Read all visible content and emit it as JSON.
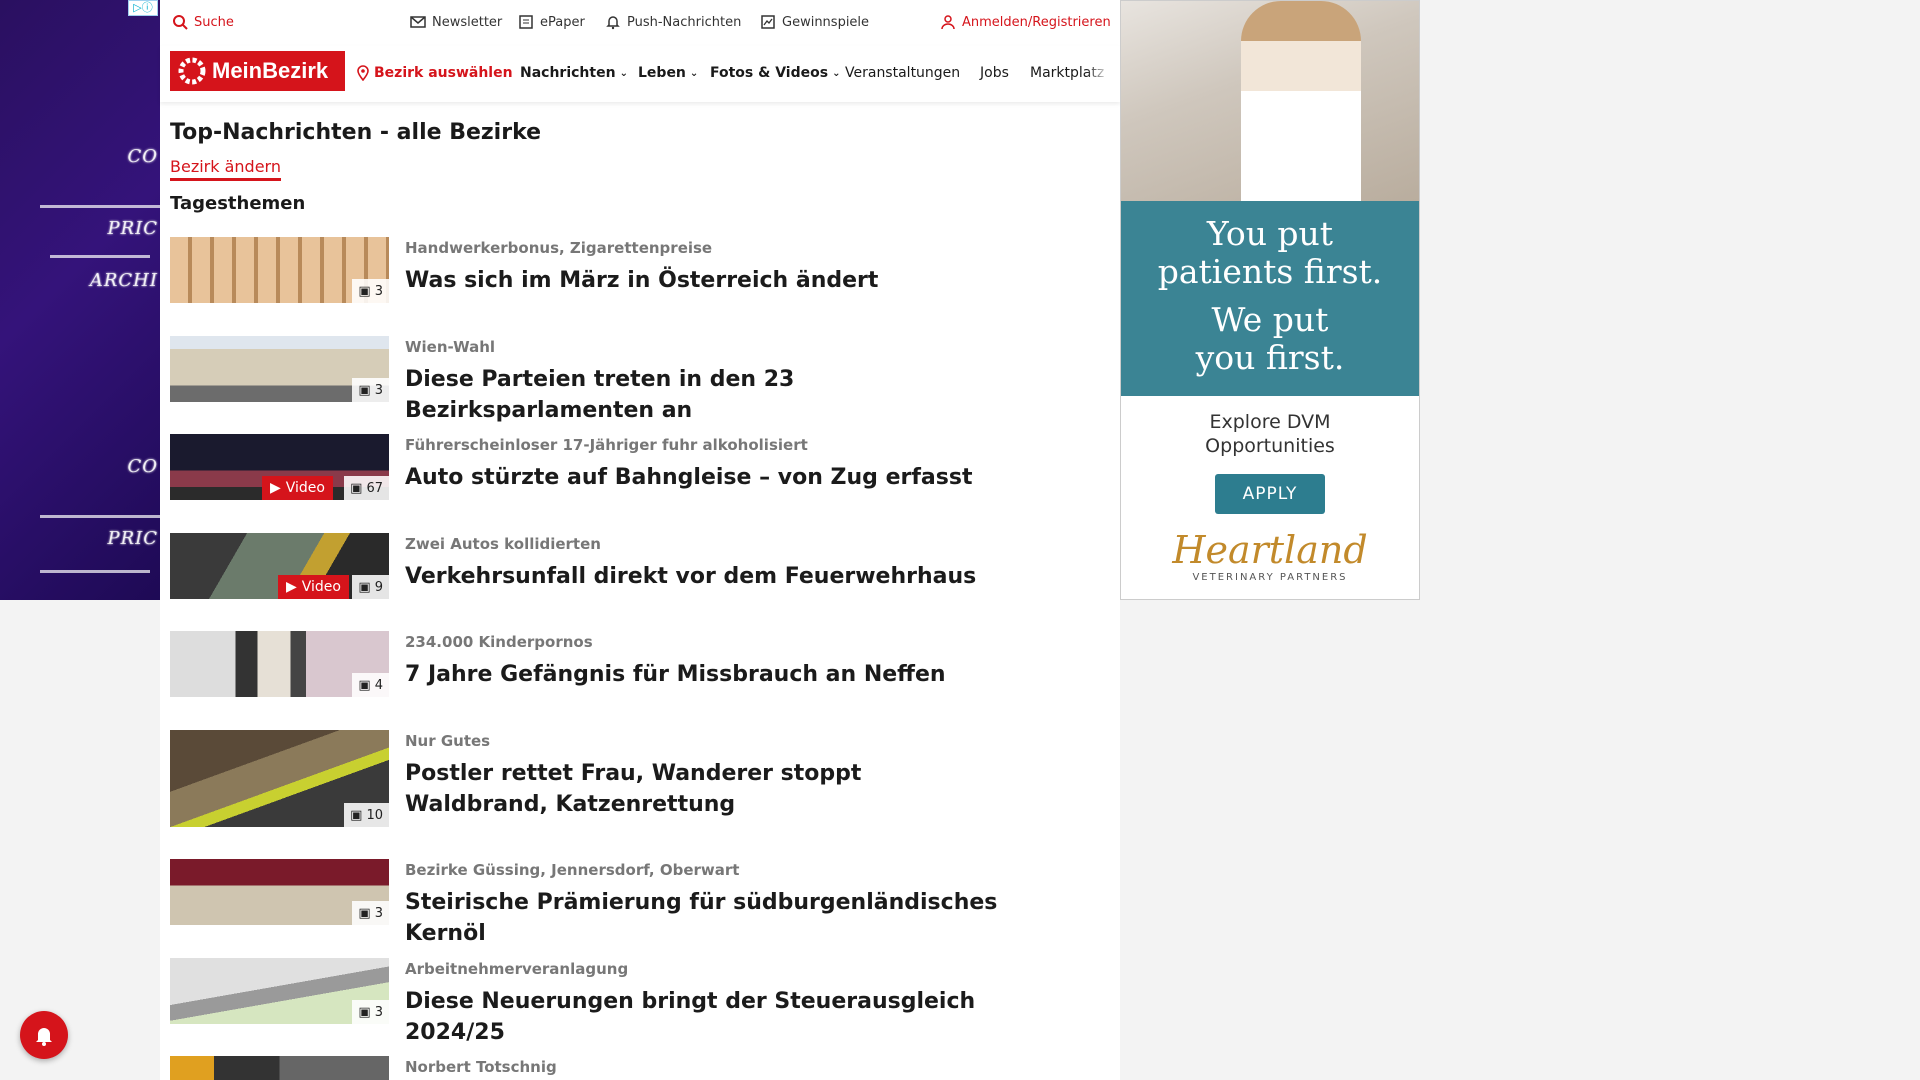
{
  "topbar": {
    "search": "Suche",
    "newsletter": "Newsletter",
    "epaper": "ePaper",
    "push": "Push-Nachrichten",
    "games": "Gewinnspiele",
    "login": "Anmelden/Registrieren"
  },
  "nav": {
    "logo": "MeinBezirk",
    "district": "Bezirk auswählen",
    "items": [
      "Nachrichten",
      "Leben",
      "Fotos & Videos",
      "Veranstaltungen",
      "Jobs",
      "Marktplatz"
    ]
  },
  "page": {
    "title": "Top-Nachrichten - alle Bezirke",
    "change_district": "Bezirk ändern",
    "section": "Tagesthemen"
  },
  "articles": [
    {
      "kicker": "Handwerkerbonus, Zigarettenpreise",
      "headline": "Was sich im März in Österreich ändert",
      "count": "3",
      "video": ""
    },
    {
      "kicker": "Wien-Wahl",
      "headline": "Diese Parteien treten in den 23 Bezirksparlamenten an",
      "count": "3",
      "video": ""
    },
    {
      "kicker": "Führerscheinloser 17-Jähriger fuhr alkoholisiert",
      "headline": "Auto stürzte auf Bahngleise – von Zug erfasst",
      "count": "67",
      "video": "Video"
    },
    {
      "kicker": "Zwei Autos kollidierten",
      "headline": "Verkehrsunfall direkt vor dem Feuerwehrhaus",
      "count": "9",
      "video": "Video"
    },
    {
      "kicker": "234.000 Kinderpornos",
      "headline": "7 Jahre Gefängnis für Missbrauch an Neffen",
      "count": "4",
      "video": ""
    },
    {
      "kicker": "Nur Gutes",
      "headline": "Postler rettet Frau, Wanderer stoppt Waldbrand, Katzenrettung",
      "count": "10",
      "video": ""
    },
    {
      "kicker": "Bezirke Güssing, Jennersdorf, Oberwart",
      "headline": "Steirische Prämierung für südburgenländisches Kernöl",
      "count": "3",
      "video": ""
    },
    {
      "kicker": "Arbeitnehmerveranlagung",
      "headline": "Diese Neuerungen bringt der Steuerausgleich 2024/25",
      "count": "3",
      "video": ""
    },
    {
      "kicker": "Norbert Totschnig",
      "headline": "",
      "count": "",
      "video": ""
    }
  ],
  "ad": {
    "line1": "You put",
    "line2": "patients first.",
    "line3": "We put",
    "line4": "you first.",
    "explore1": "Explore DVM",
    "explore2": "Opportunities",
    "apply": "APPLY",
    "brand": "Heartland",
    "brand_sub": "VETERINARY PARTNERS"
  },
  "skin": {
    "text1": "CO",
    "text2": "PRIC",
    "text3": "ARCHI"
  },
  "colors": {
    "brand_red": "#d5141b",
    "ad_teal": "#3b8494",
    "skin_purple": "#2a1060"
  }
}
